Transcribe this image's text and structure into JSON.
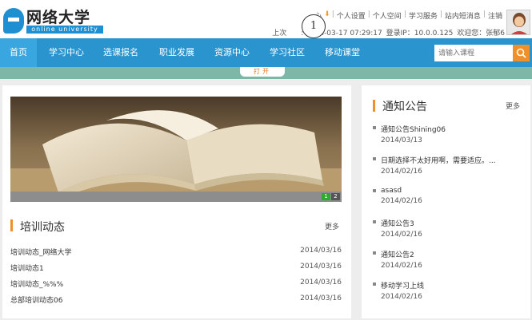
{
  "logo": {
    "cn": "网络大学",
    "en": "online university"
  },
  "toplinks": [
    "个人设置",
    "个人空间",
    "学习服务",
    "站内短消息",
    "注销"
  ],
  "toplinks_prefix": "心",
  "login": {
    "last_login_label": "上次",
    "last_login_time": ": 2014-03-17 07:29:17",
    "ip_label": "登录IP：",
    "ip": "10.0.0.125",
    "welcome": "欢迎您：张郁6"
  },
  "callout_number": "1",
  "nav": [
    "首页",
    "学习中心",
    "选课报名",
    "职业发展",
    "资源中心",
    "学习社区",
    "移动课堂"
  ],
  "search": {
    "placeholder": "请输入课程"
  },
  "open_tab": "打开",
  "banner_pages": [
    "1",
    "2"
  ],
  "training": {
    "title": "培训动态",
    "more": "更多",
    "items": [
      {
        "title": "培训动态_网络大学",
        "date": "2014/03/16"
      },
      {
        "title": "培训动态1",
        "date": "2014/03/16"
      },
      {
        "title": "培训动态_%%%",
        "date": "2014/03/16"
      },
      {
        "title": "总部培训动态06",
        "date": "2014/03/16"
      }
    ]
  },
  "notices": {
    "title": "通知公告",
    "more": "更多",
    "items": [
      {
        "title": "通知公告Shining06",
        "date": "2014/03/13"
      },
      {
        "title": "日期选择不太好用啊，需要适应。...",
        "date": "2014/02/16"
      },
      {
        "title": "asasd",
        "date": "2014/02/16"
      },
      {
        "title": "通知公告3",
        "date": "2014/02/16"
      },
      {
        "title": "通知公告2",
        "date": "2014/02/16"
      },
      {
        "title": "移动学习上线",
        "date": "2014/02/16"
      }
    ]
  },
  "colors": {
    "nav": "#2a94cf",
    "accent": "#f0902a",
    "teal": "#7fb7a6"
  }
}
